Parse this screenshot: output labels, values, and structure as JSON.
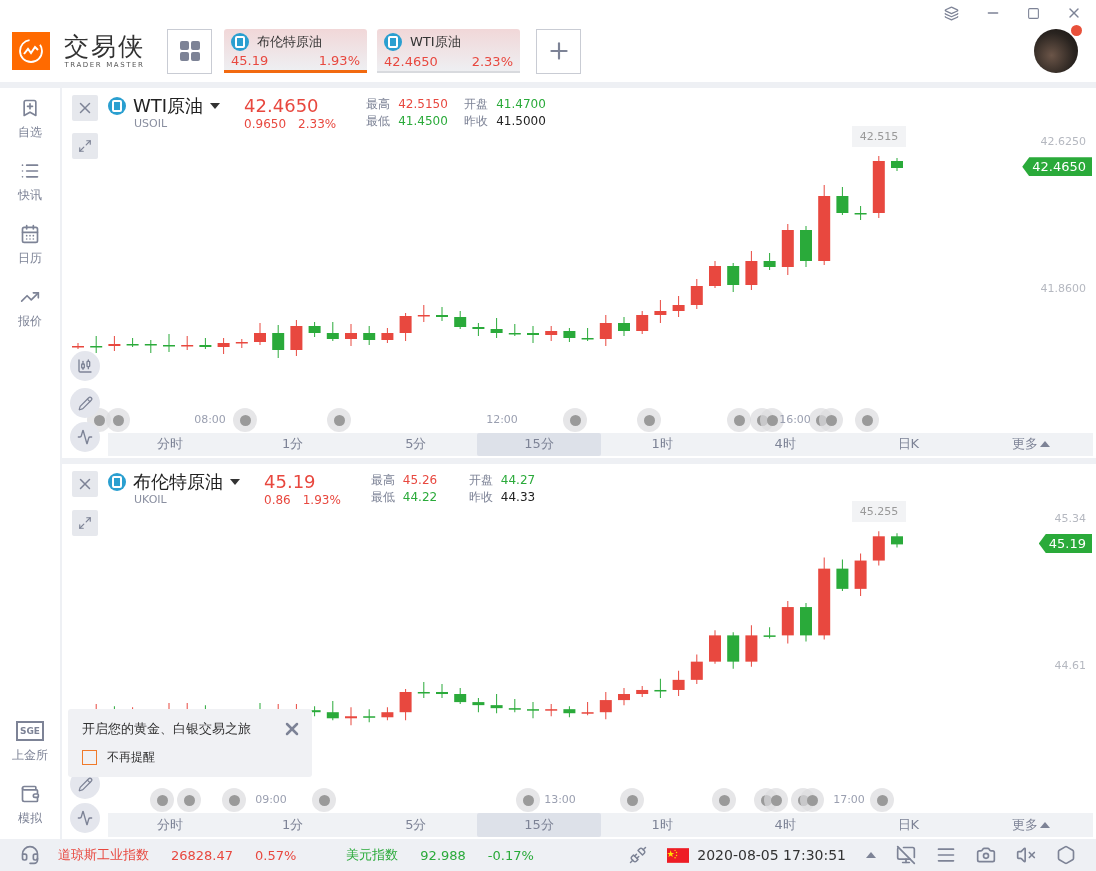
{
  "app": {
    "name": "交易侠",
    "tagline": "TRADER MASTER"
  },
  "tabs": [
    {
      "name": "布伦特原油",
      "price": "45.19",
      "change": "1.93%",
      "color": "#e8483f",
      "selected": true
    },
    {
      "name": "WTI原油",
      "price": "42.4650",
      "change": "2.33%",
      "color": "#e8483f",
      "selected": false
    }
  ],
  "user": {
    "notification": true
  },
  "sidebar": {
    "top": [
      {
        "kind": "watchlist",
        "label": "自选"
      },
      {
        "kind": "news",
        "label": "快讯"
      },
      {
        "kind": "calendar",
        "label": "日历"
      },
      {
        "kind": "quotes",
        "label": "报价"
      }
    ],
    "bottom": [
      {
        "kind": "sge",
        "label": "上金所",
        "badge": "SGE"
      },
      {
        "kind": "wallet",
        "label": "模拟"
      }
    ]
  },
  "panels": [
    {
      "symbol": "WTI原油",
      "code": "USOIL",
      "price": "42.4650",
      "change": "0.9650",
      "percent": "2.33%",
      "color": "#e8483f",
      "stats": [
        {
          "label": "最高",
          "value": "42.5150",
          "color": "#e8483f"
        },
        {
          "label": "开盘",
          "value": "41.4700",
          "color": "#2aaa3a"
        },
        {
          "label": "最低",
          "value": "41.4500",
          "color": "#2aaa3a"
        },
        {
          "label": "昨收",
          "value": "41.5000",
          "color": "#222222"
        }
      ],
      "y_axis": [
        "42.6250",
        "41.8600"
      ],
      "last_price": {
        "text": "42.4650",
        "color": "#2aaa3a"
      },
      "high_label": "42.515",
      "time_labels": [
        "08:00",
        "12:00",
        "16:00"
      ],
      "timeframes": [
        {
          "label": "分时",
          "selected": false
        },
        {
          "label": "1分",
          "selected": false
        },
        {
          "label": "5分",
          "selected": false
        },
        {
          "label": "15分",
          "selected": true
        },
        {
          "label": "1时",
          "selected": false
        },
        {
          "label": "4时",
          "selected": false
        },
        {
          "label": "日K",
          "selected": false
        },
        {
          "label": "更多",
          "selected": false
        }
      ]
    },
    {
      "symbol": "布伦特原油",
      "code": "UKOIL",
      "price": "45.19",
      "change": "0.86",
      "percent": "1.93%",
      "color": "#e8483f",
      "stats": [
        {
          "label": "最高",
          "value": "45.26",
          "color": "#e8483f"
        },
        {
          "label": "开盘",
          "value": "44.27",
          "color": "#2aaa3a"
        },
        {
          "label": "最低",
          "value": "44.22",
          "color": "#2aaa3a"
        },
        {
          "label": "昨收",
          "value": "44.33",
          "color": "#222222"
        }
      ],
      "y_axis": [
        "45.34",
        "44.61"
      ],
      "last_price": {
        "text": "45.19",
        "color": "#2aaa3a"
      },
      "high_label": "45.255",
      "time_labels": [
        "09:00",
        "13:00",
        "17:00"
      ],
      "timeframes": [
        {
          "label": "分时",
          "selected": false
        },
        {
          "label": "1分",
          "selected": false
        },
        {
          "label": "5分",
          "selected": false
        },
        {
          "label": "15分",
          "selected": true
        },
        {
          "label": "1时",
          "selected": false
        },
        {
          "label": "4时",
          "selected": false
        },
        {
          "label": "日K",
          "selected": false
        },
        {
          "label": "更多",
          "selected": false
        }
      ],
      "reminder": {
        "text": "开启您的黄金、白银交易之旅",
        "checkbox": {
          "label": "不再提醒",
          "checked": false
        }
      }
    }
  ],
  "status_bar": {
    "indices": [
      {
        "name": "道琼斯工业指数",
        "value": "26828.47",
        "change": "0.57%",
        "color": "#e8483f"
      },
      {
        "name": "美元指数",
        "value": "92.988",
        "change": "-0.17%",
        "color": "#2aaa3a"
      }
    ],
    "datetime": "2020-08-05 17:30:51"
  }
}
